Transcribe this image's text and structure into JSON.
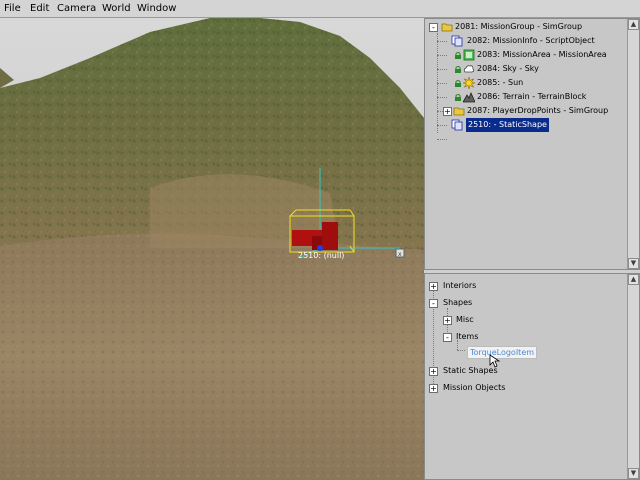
{
  "menu": {
    "items": [
      "File",
      "Edit",
      "Camera",
      "World",
      "Window"
    ]
  },
  "viewport": {
    "selected_object_label": "2510: (null)"
  },
  "mission_tree": {
    "items": [
      {
        "label": "2081: MissionGroup - SimGroup",
        "icon": "folder-icon",
        "selected": false
      },
      {
        "label": "2082: MissionInfo - ScriptObject",
        "icon": "script-object-icon",
        "selected": false
      },
      {
        "label": "2083: MissionArea - MissionAreа",
        "icon": "mission-area-icon",
        "selected": false
      },
      {
        "label": "2084: Sky - Sky",
        "icon": "sky-icon",
        "selected": false
      },
      {
        "label": "2085: - Sun",
        "icon": "sun-icon",
        "selected": false
      },
      {
        "label": "2086: Terrain - TerrainBlock",
        "icon": "terrain-icon",
        "selected": false
      },
      {
        "label": "2087: PlayerDropPoints - SimGroup",
        "icon": "folder-icon",
        "selected": false
      },
      {
        "label": "2510: - StaticShape",
        "icon": "static-shape-icon",
        "selected": true
      }
    ]
  },
  "creator_tree": {
    "items": [
      {
        "label": "Interiors",
        "expander": "+"
      },
      {
        "label": "Shapes",
        "expander": "-"
      },
      {
        "label": "Misc",
        "expander": "+"
      },
      {
        "label": "Items",
        "expander": "-"
      },
      {
        "label": "TorqueLogoItem",
        "expander": ""
      },
      {
        "label": "Static Shapes",
        "expander": "+"
      },
      {
        "label": "Mission Objects",
        "expander": "+"
      }
    ]
  },
  "colors": {
    "selection": "#0a2a8c",
    "hover_text": "#4a8ad4",
    "bounding_box": "#f0e020",
    "object": "#b01010"
  }
}
